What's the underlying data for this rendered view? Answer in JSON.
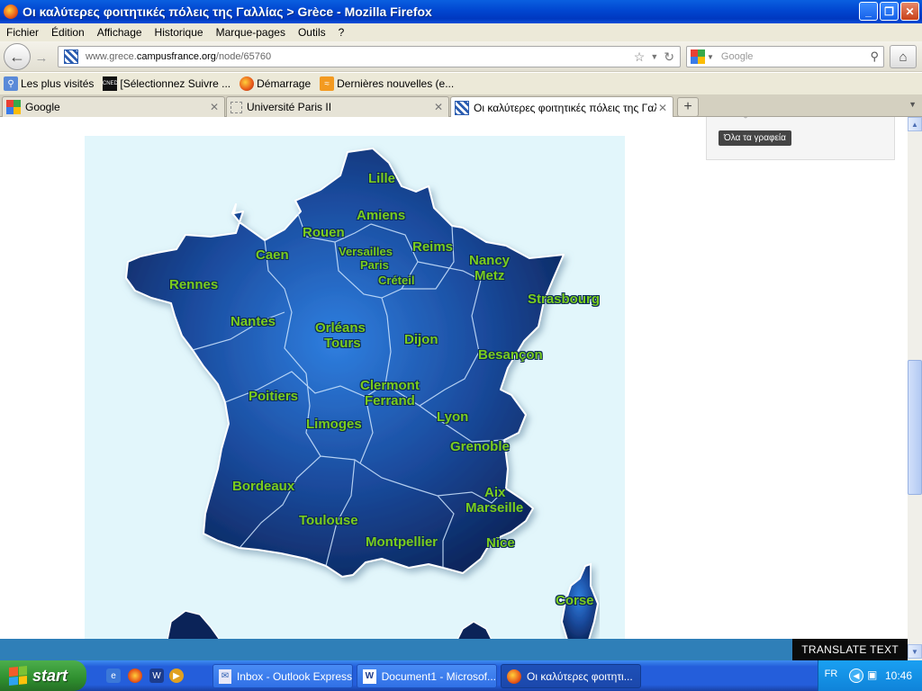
{
  "window": {
    "title": "Οι καλύτερες φοιτητικές πόλεις της Γαλλίας > Grèce - Mozilla Firefox",
    "controls": {
      "minimize": "_",
      "maximize": "❐",
      "close": "✕"
    }
  },
  "menu": [
    "Fichier",
    "Édition",
    "Affichage",
    "Historique",
    "Marque-pages",
    "Outils",
    "?"
  ],
  "nav": {
    "url_prefix": "www.grece.",
    "url_domain": "campusfrance.org",
    "url_path": "/node/65760",
    "search_placeholder": "Google"
  },
  "bookmarks": [
    {
      "label": "Les plus visités",
      "icon": "search-icon"
    },
    {
      "label": "[Sélectionnez Suivre ...",
      "icon": "cned-icon"
    },
    {
      "label": "Démarrage",
      "icon": "firefox-icon"
    },
    {
      "label": "Dernières nouvelles (e...",
      "icon": "rss-icon"
    }
  ],
  "tabs": [
    {
      "label": "Google",
      "active": false
    },
    {
      "label": "Université Paris II",
      "active": false
    },
    {
      "label": "Οι καλύτερες φοιτητικές πόλεις της Γαλλί...",
      "active": true
    }
  ],
  "sidebar": {
    "button": "Όλα τα γραφεία"
  },
  "map": {
    "cities": [
      {
        "name": "Lille"
      },
      {
        "name": "Amiens"
      },
      {
        "name": "Rouen"
      },
      {
        "name": "Caen"
      },
      {
        "name": "Versailles"
      },
      {
        "name": "Paris"
      },
      {
        "name": "Créteil"
      },
      {
        "name": "Reims"
      },
      {
        "name": "Nancy"
      },
      {
        "name": "Metz"
      },
      {
        "name": "Strasbourg"
      },
      {
        "name": "Rennes"
      },
      {
        "name": "Nantes"
      },
      {
        "name": "Orléans"
      },
      {
        "name": "Tours"
      },
      {
        "name": "Dijon"
      },
      {
        "name": "Besançon"
      },
      {
        "name": "Poitiers"
      },
      {
        "name": "Clermont"
      },
      {
        "name": "Ferrand"
      },
      {
        "name": "Lyon"
      },
      {
        "name": "Limoges"
      },
      {
        "name": "Grenoble"
      },
      {
        "name": "Bordeaux"
      },
      {
        "name": "Aix"
      },
      {
        "name": "Marseille"
      },
      {
        "name": "Toulouse"
      },
      {
        "name": "Montpellier"
      },
      {
        "name": "Nice"
      },
      {
        "name": "Corse"
      }
    ],
    "colors": {
      "background": "#e2f6fb",
      "region": "#1a4a9c",
      "label": "#7acc1e"
    }
  },
  "translate_label": "TRANSLATE TEXT",
  "taskbar": {
    "start": "start",
    "tasks": [
      {
        "label": "Inbox - Outlook Express",
        "active": false
      },
      {
        "label": "Document1 - Microsof...",
        "active": false
      },
      {
        "label": "Οι καλύτερες φοιτητι...",
        "active": true
      }
    ],
    "language": "FR",
    "clock": "10:46"
  }
}
